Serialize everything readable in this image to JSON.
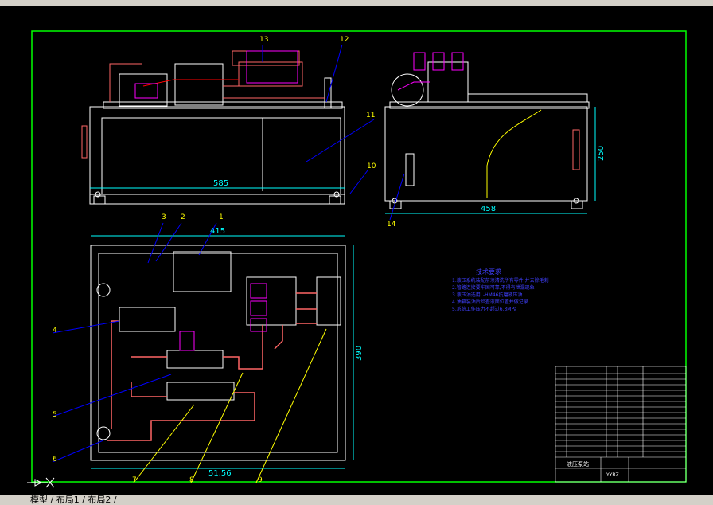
{
  "toolbar": {
    "label": ""
  },
  "status_tab": "模型 / 布局1 / 布局2 /",
  "colors": {
    "frame": "#00ff00",
    "outline": "#ffffff",
    "dim": "#00ffff",
    "leader": "#0000ff",
    "pipe": "#ff6666",
    "hydraulic": "#ff00ff",
    "callout_yellow": "#ffff00",
    "note": "#4040ff"
  },
  "callouts_top": [
    "13",
    "12",
    "11",
    "10",
    "14"
  ],
  "callouts_plan": [
    "1",
    "2",
    "3",
    "4",
    "5",
    "6",
    "7",
    "8",
    "9"
  ],
  "dims": {
    "front_width": "585",
    "side_width": "458",
    "side_height": "250",
    "plan_width": "415",
    "plan_height": "390",
    "plan_bottom": "51.56"
  },
  "tech_note_title": "技术要求",
  "tech_notes": [
    "1.液压系统装配前须清洗所有零件,并去除毛刺",
    "2.管路连接要牢固可靠,不得有泄漏现象",
    "3.液压油选用L-HM46抗磨液压油",
    "4.油箱装油后检查液面位置并做记录",
    "5.系统工作压力不超过6.3MPa"
  ],
  "title_block": {
    "title": "液压泵站",
    "drawing_no": "YYBZ"
  }
}
